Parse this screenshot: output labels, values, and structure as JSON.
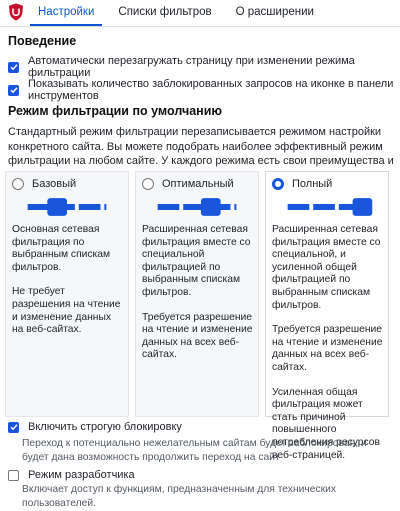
{
  "tabs": [
    {
      "label": "Настройки",
      "active": true
    },
    {
      "label": "Списки фильтров",
      "active": false
    },
    {
      "label": "О расширении",
      "active": false
    }
  ],
  "behavior": {
    "title": "Поведение",
    "options": [
      {
        "label": "Автоматически перезагружать страницу при изменении режима фильтрации",
        "checked": true
      },
      {
        "label": "Показывать количество заблокированных запросов на иконке в панели инструментов",
        "checked": true
      }
    ]
  },
  "filtering": {
    "title": "Режим фильтрации по умолчанию",
    "description": "Стандартный режим фильтрации перезаписывается режимом настройки конкретного сайта. Вы можете подобрать наиболее эффективный режим фильтрации на любом сайте. У каждого режима есть свои преимущества и недостатки.",
    "modes": [
      {
        "name": "Базовый",
        "selected": false,
        "level": 0.33,
        "text": [
          "Основная сетевая фильтрация по выбранным спискам фильтров.",
          "Не требует разрешения на чтение и изменение данных на веб-сайтах."
        ]
      },
      {
        "name": "Оптимальный",
        "selected": false,
        "level": 0.66,
        "text": [
          "Расширенная сетевая фильтрация вместе со специальной фильтрацией по выбранным спискам фильтров.",
          "Требуется разрешение на чтение и изменение данных на всех веб-сайтах."
        ]
      },
      {
        "name": "Полный",
        "selected": true,
        "level": 1.0,
        "text": [
          "Расширенная сетевая фильтрация вместе со специальной, и усиленной общей фильтрацией по выбранным спискам фильтров.",
          "Требуется разрешение на чтение и изменение данных на всех веб-сайтах.",
          "Усиленная общая фильтрация может стать причиной повышенного потребления ресурсов веб-страницей."
        ]
      }
    ]
  },
  "strict": {
    "label": "Включить строгую блокировку",
    "checked": true,
    "note": "Переход к потенциально нежелательным сайтам будет заблокирован, и будет дана возможность продолжить переход на сайт"
  },
  "developer": {
    "label": "Режим разработчика",
    "checked": false,
    "note": "Включает доступ к функциям, предназначенным для технических пользователей."
  },
  "colors": {
    "accent": "#1a56db",
    "tab_active": "#0b57d0",
    "logo_red": "#c8102e",
    "card_bg": "#f6f7f9"
  },
  "icons": {
    "logo": "ublock-shield-icon",
    "check": "checkmark-icon"
  }
}
